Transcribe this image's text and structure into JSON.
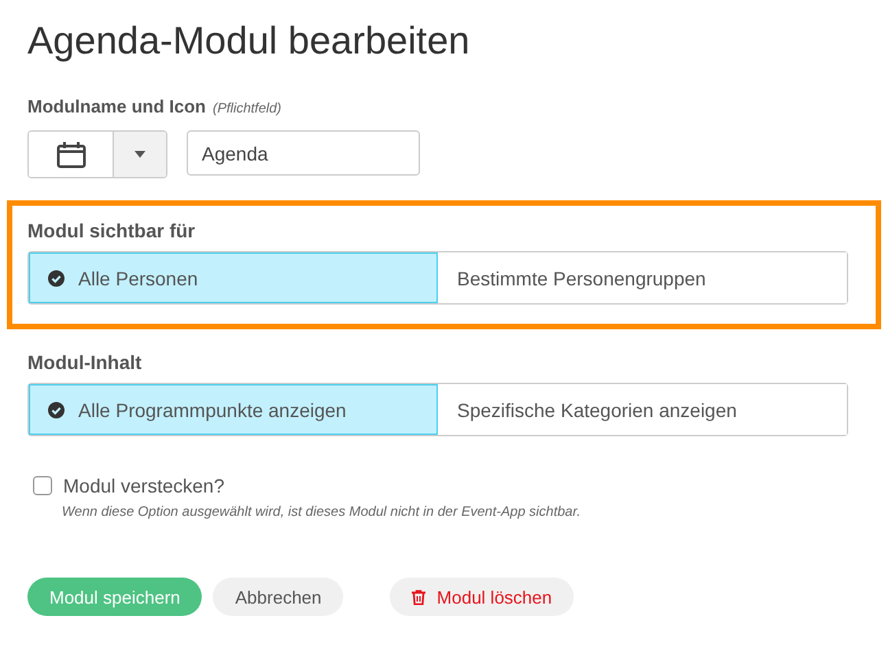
{
  "title": "Agenda-Modul bearbeiten",
  "name_field": {
    "label": "Modulname und Icon",
    "hint": "(Pflichtfeld)",
    "value": "Agenda"
  },
  "sections": [
    {
      "label": "Modul sichtbar für",
      "highlighted": true,
      "options": [
        {
          "label": "Alle Personen",
          "selected": true
        },
        {
          "label": "Bestimmte Personengruppen",
          "selected": false
        }
      ]
    },
    {
      "label": "Modul-Inhalt",
      "highlighted": false,
      "options": [
        {
          "label": "Alle Programmpunkte anzeigen",
          "selected": true
        },
        {
          "label": "Spezifische Kategorien anzeigen",
          "selected": false
        }
      ]
    }
  ],
  "hide_option": {
    "label": "Modul verstecken?",
    "checked": false,
    "description": "Wenn diese Option ausgewählt wird, ist dieses Modul nicht in der Event-App sichtbar."
  },
  "buttons": [
    {
      "label": "Modul speichern",
      "kind": "primary"
    },
    {
      "label": "Abbrechen",
      "kind": "secondary"
    },
    {
      "label": "Modul löschen",
      "kind": "danger"
    }
  ]
}
